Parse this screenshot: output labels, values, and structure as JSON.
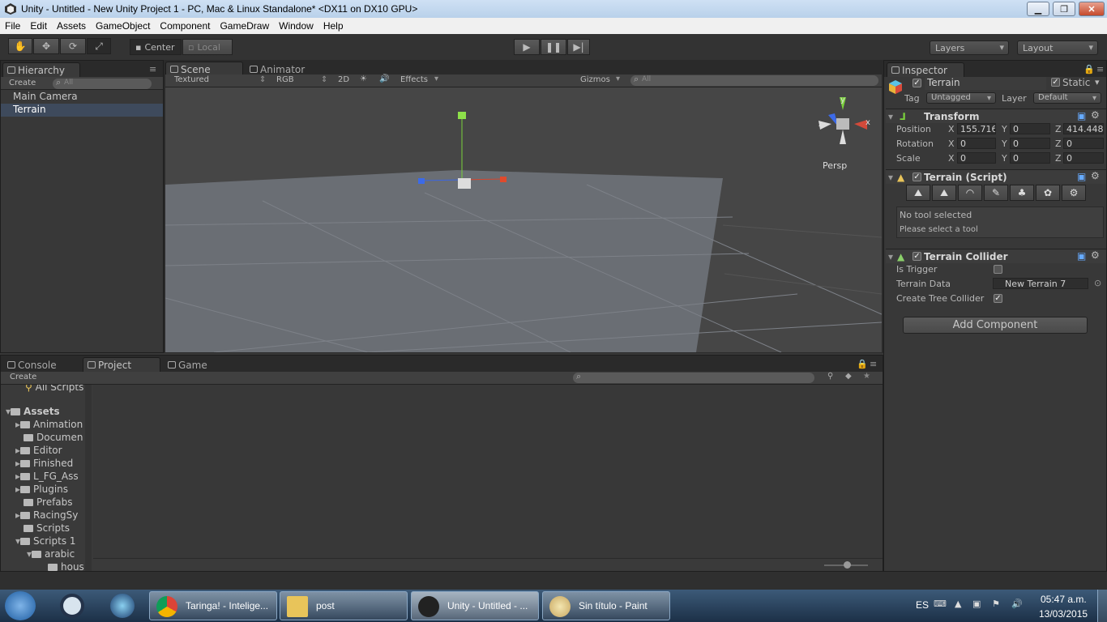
{
  "window": {
    "title": "Unity - Untitled - New Unity Project 1 - PC, Mac & Linux Standalone* <DX11 on DX10 GPU>"
  },
  "menu": [
    "File",
    "Edit",
    "Assets",
    "GameObject",
    "Component",
    "GameDraw",
    "Window",
    "Help"
  ],
  "toolbar": {
    "pivot": "Center",
    "space": "Local",
    "layers": "Layers",
    "layout": "Layout"
  },
  "hierarchy": {
    "tab": "Hierarchy",
    "create": "Create",
    "search_placeholder": "All",
    "items": [
      "Main Camera",
      "Terrain"
    ]
  },
  "scene": {
    "tab_scene": "Scene",
    "tab_animator": "Animator",
    "render_mode": "Textured",
    "color_mode": "RGB",
    "mode_2d": "2D",
    "effects": "Effects",
    "gizmos": "Gizmos",
    "search_placeholder": "All",
    "persp": "Persp",
    "axis_x": "x",
    "axis_y": "y",
    "axis_z": "z"
  },
  "inspector": {
    "tab": "Inspector",
    "object_name": "Terrain",
    "static": "Static",
    "tag_label": "Tag",
    "tag_value": "Untagged",
    "layer_label": "Layer",
    "layer_value": "Default",
    "transform": {
      "title": "Transform",
      "position": "Position",
      "rotation": "Rotation",
      "scale": "Scale",
      "x": "X",
      "y": "Y",
      "z": "Z",
      "pos_x": "155.716",
      "pos_y": "0",
      "pos_z": "414.448",
      "rot_x": "0",
      "rot_y": "0",
      "rot_z": "0",
      "scl_x": "0",
      "scl_y": "0",
      "scl_z": "0"
    },
    "terrain_script": {
      "title": "Terrain (Script)",
      "no_tool": "No tool selected",
      "please": "Please select a tool"
    },
    "collider": {
      "title": "Terrain Collider",
      "is_trigger": "Is Trigger",
      "terrain_data": "Terrain Data",
      "terrain_data_value": "New Terrain 7",
      "tree_collider": "Create Tree Collider"
    },
    "add_component": "Add Component"
  },
  "bottom": {
    "tab_console": "Console",
    "tab_project": "Project",
    "tab_game": "Game",
    "create": "Create",
    "all_scripts": "All Scripts",
    "assets": "Assets",
    "folders": [
      "Animation",
      "Documen",
      "Editor",
      "Finished",
      "L_FG_Ass",
      "Plugins",
      "Prefabs",
      "RacingSy",
      "Scripts",
      "Scripts 1",
      "arabic",
      "hous"
    ]
  },
  "taskbar": {
    "tasks": [
      "Taringa! - Intelige...",
      "post",
      "Unity - Untitled - ...",
      "Sin título - Paint"
    ],
    "lang": "ES",
    "time": "05:47 a.m.",
    "date": "13/03/2015"
  },
  "colors": {
    "editor_bg": "#383838",
    "selection": "#3e4a5c",
    "taskbar": "#1c3047"
  }
}
